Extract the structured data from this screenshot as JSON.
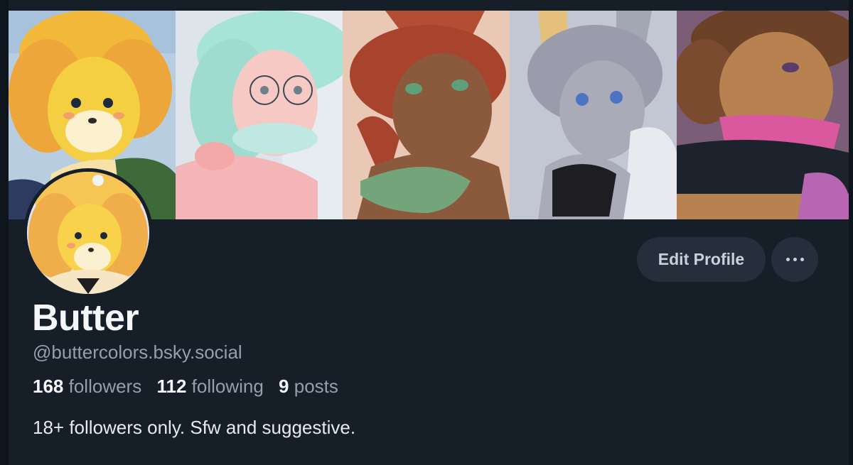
{
  "profile": {
    "display_name": "Butter",
    "handle": "@buttercolors.bsky.social",
    "stats": {
      "followers_count": "168",
      "followers_label": "followers",
      "following_count": "112",
      "following_label": "following",
      "posts_count": "9",
      "posts_label": "posts"
    },
    "bio": "18+ followers only. Sfw and suggestive."
  },
  "actions": {
    "edit_label": "Edit Profile",
    "more_icon": "ellipsis-icon"
  },
  "colors": {
    "background": "#161e27",
    "button_bg": "#252f3b",
    "text_primary": "#f4f6f8",
    "text_secondary": "#93a0ae"
  }
}
